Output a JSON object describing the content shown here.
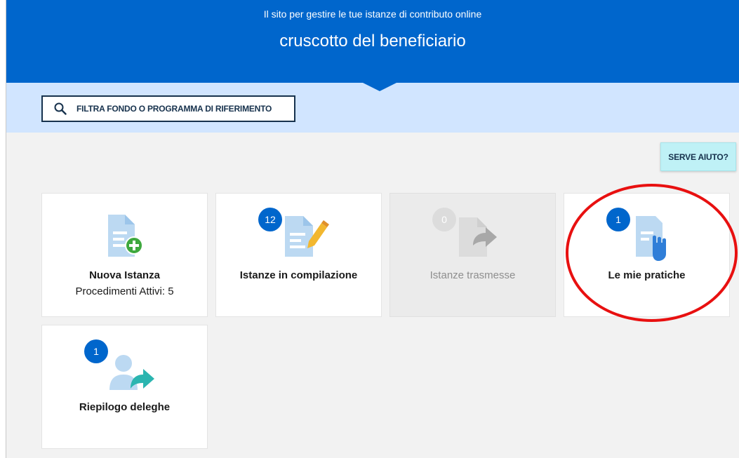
{
  "header": {
    "subtitle": "Il sito per gestire le tue istanze di contributo online",
    "title": "cruscotto del beneficiario"
  },
  "filter": {
    "label": "FILTRA FONDO O PROGRAMMA DI RIFERIMENTO",
    "icon": "search-icon"
  },
  "help": {
    "label": "SERVE AIUTO?"
  },
  "cards": {
    "nuova_istanza": {
      "title": "Nuova Istanza",
      "subtitle": "Procedimenti Attivi: 5",
      "icon": "new-document-plus-icon"
    },
    "in_compilazione": {
      "title": "Istanze in compilazione",
      "badge": "12",
      "icon": "document-pencil-icon"
    },
    "trasmesse": {
      "title": "Istanze trasmesse",
      "badge": "0",
      "icon": "document-send-icon"
    },
    "mie_pratiche": {
      "title": "Le mie pratiche",
      "badge": "1",
      "icon": "document-hand-icon"
    },
    "deleghe": {
      "title": "Riepilogo deleghe",
      "badge": "1",
      "icon": "user-delegate-icon"
    }
  },
  "colors": {
    "primary": "#0066cc",
    "band": "#d1e5ff",
    "icon_light": "#bcd9f2",
    "accent_green": "#3ea83e",
    "accent_yellow": "#f2b730",
    "accent_teal": "#2bb5b0",
    "annotation": "#e81010"
  }
}
